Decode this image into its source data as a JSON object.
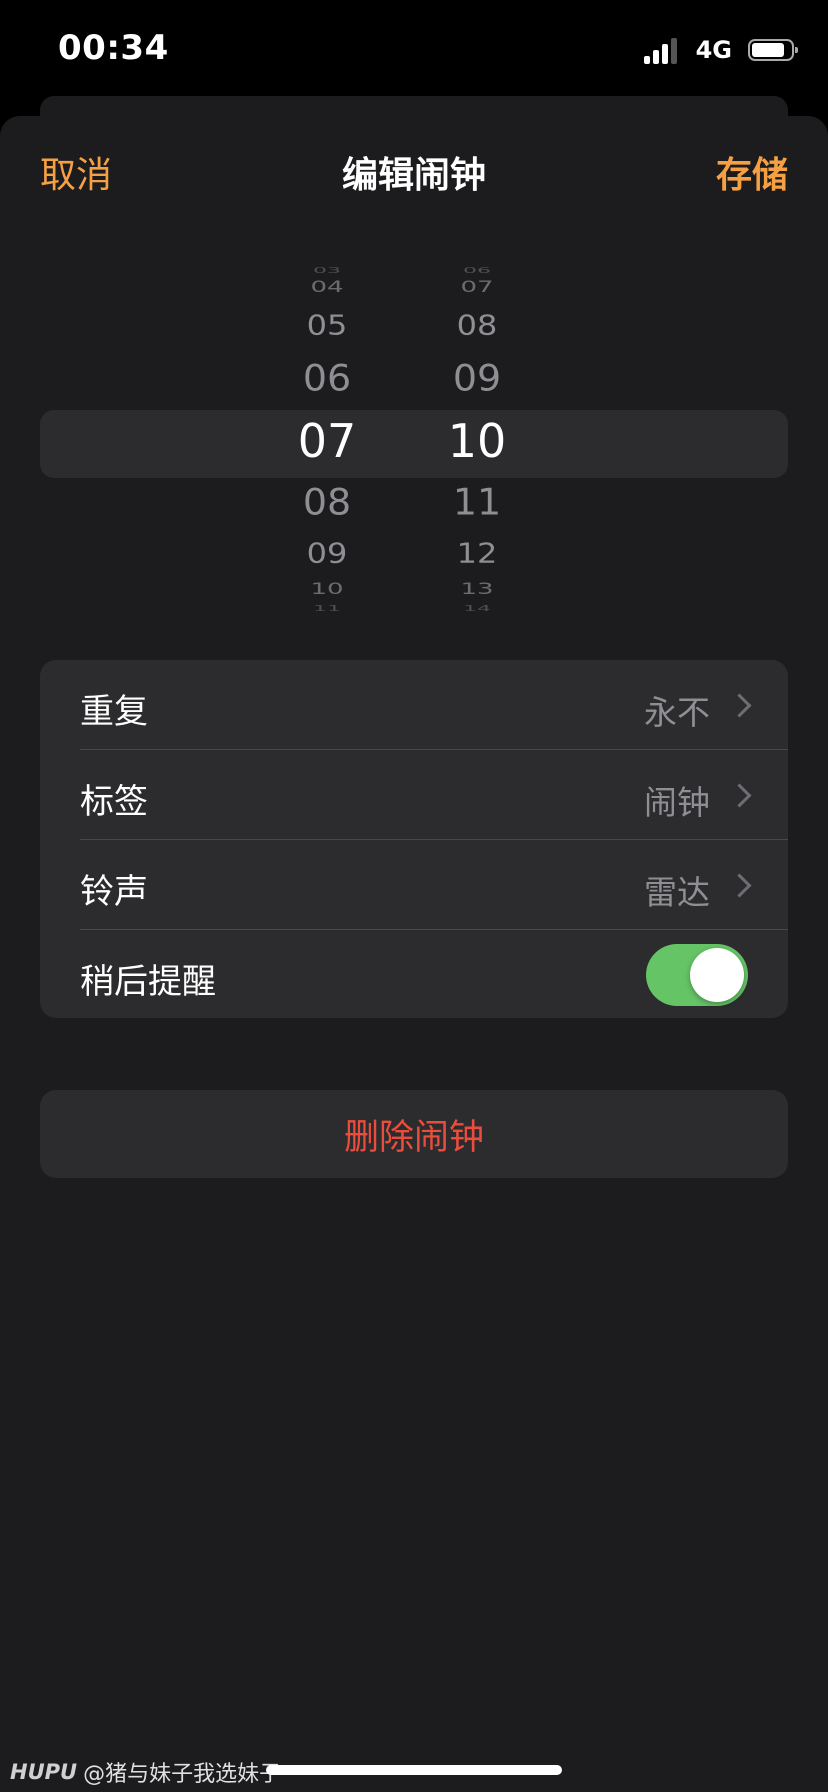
{
  "status_bar": {
    "time": "00:34",
    "network": "4G",
    "signal_level": 3,
    "battery_percent": 85
  },
  "nav": {
    "cancel_label": "取消",
    "title": "编辑闹钟",
    "save_label": "存储"
  },
  "picker": {
    "hours": [
      "03",
      "04",
      "05",
      "06",
      "07",
      "08",
      "09",
      "10",
      "11"
    ],
    "minutes": [
      "06",
      "07",
      "08",
      "09",
      "10",
      "11",
      "12",
      "13",
      "14"
    ],
    "selected_hour": "07",
    "selected_minute": "10"
  },
  "settings": {
    "rows": [
      {
        "label": "重复",
        "value": "永不"
      },
      {
        "label": "标签",
        "value": "闹钟"
      },
      {
        "label": "铃声",
        "value": "雷达"
      },
      {
        "label": "稍后提醒",
        "toggle_on": true
      }
    ]
  },
  "delete_label": "删除闹钟",
  "watermark": {
    "logo": "HUPU",
    "user": "@猪与妹子我选妹子"
  },
  "colors": {
    "accent": "#f5a042",
    "destructive": "#eb4d3d",
    "toggle_on": "#65c466",
    "sheet_bg": "#1c1c1e",
    "card_bg": "#2c2c2e"
  }
}
